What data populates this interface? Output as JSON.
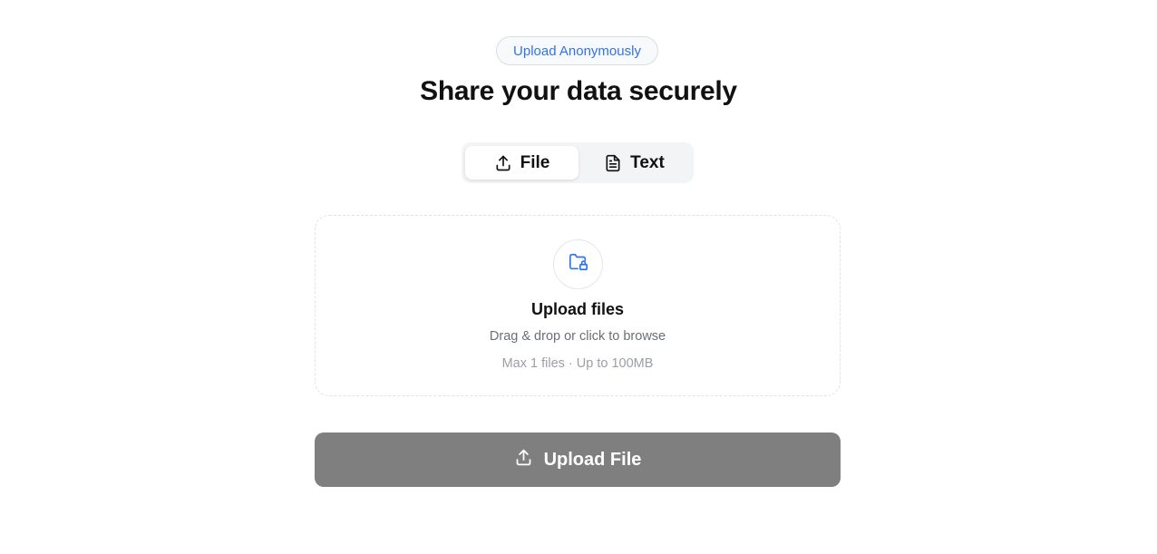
{
  "header": {
    "badge_label": "Upload Anonymously",
    "title": "Share your data securely"
  },
  "tabs": [
    {
      "label": "File",
      "icon": "upload-icon",
      "active": true
    },
    {
      "label": "Text",
      "icon": "document-text-icon",
      "active": false
    }
  ],
  "dropzone": {
    "icon": "folder-lock-icon",
    "title": "Upload files",
    "subtitle": "Drag & drop or click to browse",
    "limits": "Max 1 files · Up to 100MB"
  },
  "upload_button": {
    "label": "Upload File",
    "icon": "upload-icon"
  },
  "colors": {
    "accent": "#2f74e8",
    "button_disabled": "#7f7f7f",
    "tab_track": "#f3f4f6"
  }
}
